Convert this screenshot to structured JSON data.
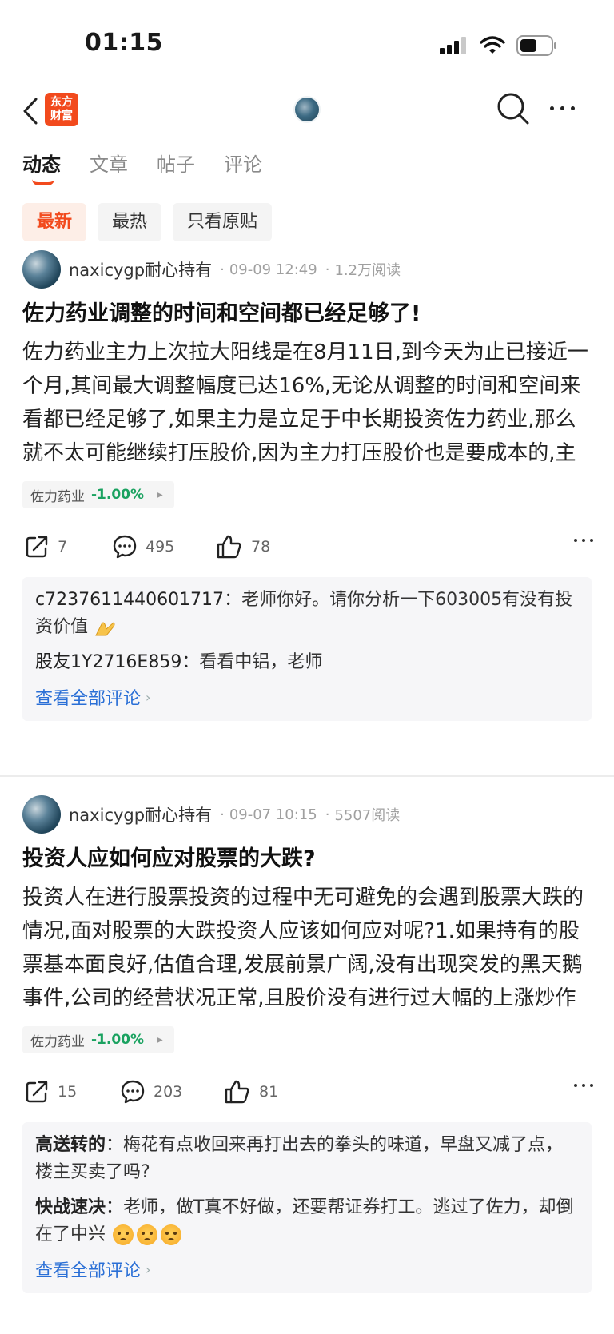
{
  "status_bar": {
    "time": "01:15"
  },
  "header": {
    "logo_line1": "东方",
    "logo_line2": "财富"
  },
  "tabs": [
    {
      "label": "动态",
      "active": true
    },
    {
      "label": "文章",
      "active": false
    },
    {
      "label": "帖子",
      "active": false
    },
    {
      "label": "评论",
      "active": false
    }
  ],
  "filters": [
    {
      "label": "最新",
      "active": true
    },
    {
      "label": "最热",
      "active": false
    },
    {
      "label": "只看原贴",
      "active": false
    }
  ],
  "posts": [
    {
      "author": "naxicygp耐心持有",
      "date": "09-09 12:49",
      "reads": "1.2万阅读",
      "title": "佐力药业调整的时间和空间都已经足够了!",
      "body": "佐力药业主力上次拉大阳线是在8月11日,到今天为止已接近一个月,其间最大调整幅度已达16%,无论从调整的时间和空间来看都已经足够了,如果主力是立足于中长期投资佐力药业,那么就不太可能继续打压股价,因为主力打压股价也是要成本的,主力不断的做空就意味着…",
      "stock_name": "佐力药业",
      "stock_change": "-1.00%",
      "shares": "7",
      "comments_count": "495",
      "likes": "78",
      "comments": [
        {
          "user": "c7237611440601717",
          "text": "老师你好。请你分析一下603005有没有投资价值"
        },
        {
          "user": "股友1Y2716E859",
          "text": "看看中铝，老师"
        }
      ],
      "view_all": "查看全部评论"
    },
    {
      "author": "naxicygp耐心持有",
      "date": "09-07 10:15",
      "reads": "5507阅读",
      "title": "投资人应如何应对股票的大跌?",
      "body": "投资人在进行股票投资的过程中无可避免的会遇到股票大跌的情况,面对股票的大跌投资人应该如何应对呢?1.如果持有的股票基本面良好,估值合理,发展前景广阔,没有出现突发的黑天鹅事件,公司的经营状况正常,且股价没有进行过大幅的上涨炒作就不用担心,耐心持股…",
      "stock_name": "佐力药业",
      "stock_change": "-1.00%",
      "shares": "15",
      "comments_count": "203",
      "likes": "81",
      "comments": [
        {
          "user": "高送转的",
          "text": "梅花有点收回来再打出去的拳头的味道，早盘又减了点，楼主买卖了吗?"
        },
        {
          "user": "快战速决",
          "text": "老师，做T真不好做，还要帮证券打工。逃过了佐力，却倒在了中兴"
        }
      ],
      "view_all": "查看全部评论"
    }
  ]
}
